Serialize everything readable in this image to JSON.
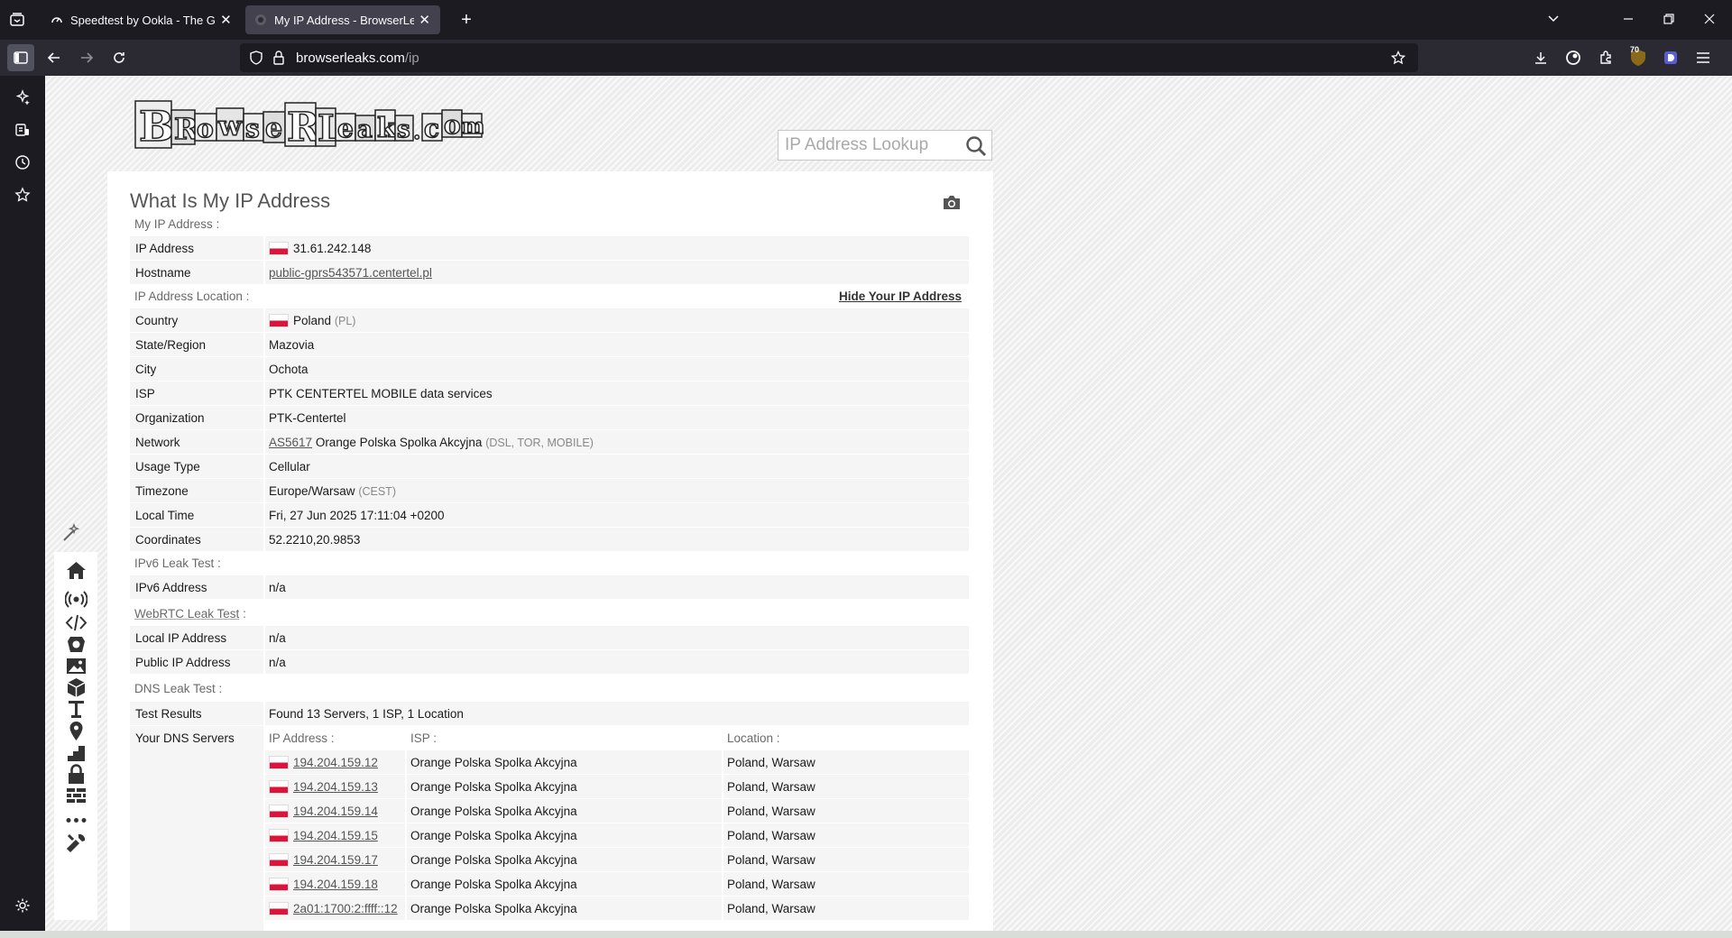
{
  "browser": {
    "tabs": [
      {
        "title": "Speedtest by Ookla - The Global Broadband Speed Test",
        "close": "✕",
        "active": false
      },
      {
        "title": "My IP Address - BrowserLeaks",
        "close": "✕",
        "active": true
      }
    ],
    "new_tab_label": "+",
    "url": {
      "domain": "browserleaks.com",
      "path": "/ip"
    },
    "extension_badge": "70"
  },
  "site": {
    "logo_text": "BrowserLeaks.com",
    "search_placeholder": "IP Address Lookup"
  },
  "page": {
    "title": "What Is My IP Address",
    "sections": {
      "my_ip": {
        "title": "My IP Address :",
        "rows": [
          {
            "label": "IP Address",
            "value": "31.61.242.148"
          },
          {
            "label": "Hostname",
            "value": "public-gprs543571.centertel.pl"
          }
        ]
      },
      "location": {
        "title": "IP Address Location :",
        "hide_link": "Hide Your IP Address",
        "rows": [
          {
            "label": "Country",
            "value": "Poland",
            "extra": "(PL)"
          },
          {
            "label": "State/Region",
            "value": "Mazovia"
          },
          {
            "label": "City",
            "value": "Ochota"
          },
          {
            "label": "ISP",
            "value": "PTK CENTERTEL MOBILE data services"
          },
          {
            "label": "Organization",
            "value": "PTK-Centertel"
          },
          {
            "label": "Network",
            "link": "AS5617",
            "value": "Orange Polska Spolka Akcyjna",
            "extra": "(DSL, TOR, MOBILE)"
          },
          {
            "label": "Usage Type",
            "value": "Cellular"
          },
          {
            "label": "Timezone",
            "value": "Europe/Warsaw",
            "extra": "(CEST)"
          },
          {
            "label": "Local Time",
            "value": "Fri, 27 Jun 2025 17:11:04 +0200"
          },
          {
            "label": "Coordinates",
            "value": "52.2210,20.9853"
          }
        ]
      },
      "ipv6": {
        "title": "IPv6 Leak Test :",
        "rows": [
          {
            "label": "IPv6 Address",
            "value": "n/a"
          }
        ]
      },
      "webrtc": {
        "title": "WebRTC Leak Test",
        "title_suffix": " :",
        "rows": [
          {
            "label": "Local IP Address",
            "value": "n/a"
          },
          {
            "label": "Public IP Address",
            "value": "n/a"
          }
        ]
      },
      "dns": {
        "title": "DNS Leak Test :",
        "test_results_label": "Test Results",
        "test_results_value": "Found 13 Servers, 1 ISP, 1 Location",
        "servers_label": "Your DNS Servers",
        "headers": [
          "IP Address :",
          "ISP :",
          "Location :"
        ],
        "servers": [
          {
            "ip": "194.204.159.12",
            "isp": "Orange Polska Spolka Akcyjna",
            "location": "Poland, Warsaw"
          },
          {
            "ip": "194.204.159.13",
            "isp": "Orange Polska Spolka Akcyjna",
            "location": "Poland, Warsaw"
          },
          {
            "ip": "194.204.159.14",
            "isp": "Orange Polska Spolka Akcyjna",
            "location": "Poland, Warsaw"
          },
          {
            "ip": "194.204.159.15",
            "isp": "Orange Polska Spolka Akcyjna",
            "location": "Poland, Warsaw"
          },
          {
            "ip": "194.204.159.17",
            "isp": "Orange Polska Spolka Akcyjna",
            "location": "Poland, Warsaw"
          },
          {
            "ip": "194.204.159.18",
            "isp": "Orange Polska Spolka Akcyjna",
            "location": "Poland, Warsaw"
          },
          {
            "ip": "2a01:1700:2:ffff::12",
            "isp": "Orange Polska Spolka Akcyjna",
            "location": "Poland, Warsaw"
          }
        ]
      }
    }
  },
  "colors": {
    "browser_bg": "#1c1b22",
    "toolbar_bg": "#2b2a33",
    "flag_red": "#dc143c",
    "row_bg": "#f5f5f5"
  }
}
